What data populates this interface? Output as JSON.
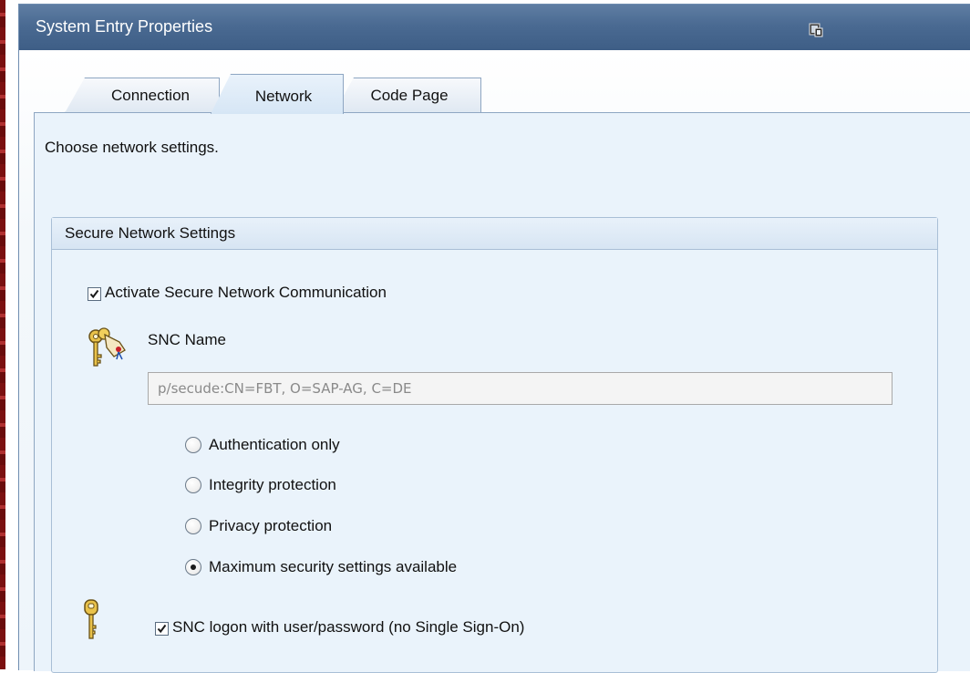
{
  "window": {
    "title": "System Entry Properties"
  },
  "tabs": [
    {
      "label": "Connection",
      "active": false
    },
    {
      "label": "Network",
      "active": true
    },
    {
      "label": "Code Page",
      "active": false
    }
  ],
  "instruction": "Choose network settings.",
  "group": {
    "title": "Secure Network Settings",
    "activate_snc": {
      "label": "Activate Secure Network Communication",
      "checked": true
    },
    "snc_name": {
      "label": "SNC Name",
      "value": "p/secude:CN=FBT, O=SAP-AG, C=DE"
    },
    "radios": [
      {
        "label": "Authentication only",
        "selected": false
      },
      {
        "label": "Integrity protection",
        "selected": false
      },
      {
        "label": "Privacy protection",
        "selected": false
      },
      {
        "label": "Maximum security settings available",
        "selected": true
      }
    ],
    "snc_logon": {
      "label": "SNC logon with user/password (no Single Sign-On)",
      "checked": true
    }
  },
  "icons": {
    "restore": "window-restore-icon",
    "snc_name": "keys-tag-icon",
    "snc_logon": "key-icon"
  },
  "colors": {
    "titlebar": "#4a6a92",
    "panel": "#eaf3fb",
    "border": "#8ea6c2"
  }
}
